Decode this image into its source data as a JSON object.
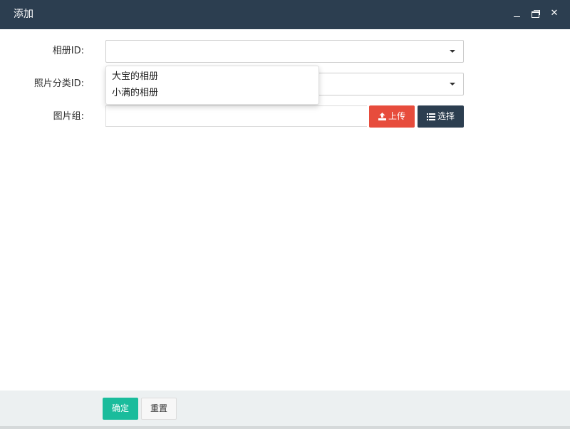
{
  "dialog": {
    "title": "添加",
    "controls": {
      "minimize_icon": "minimize-icon",
      "maximize_icon": "maximize-icon",
      "close_icon": "close-icon",
      "close_glyph": "✕"
    }
  },
  "form": {
    "album_label": "相册ID:",
    "album_value": "",
    "album_dropdown": [
      "大宝的相册",
      "小满的相册"
    ],
    "category_label": "照片分类ID:",
    "category_value": "",
    "images_label": "图片组:",
    "images_value": "",
    "upload_label": "上传",
    "choose_label": "选择"
  },
  "footer": {
    "ok_label": "确定",
    "reset_label": "重置"
  },
  "colors": {
    "titlebar": "#2c3e50",
    "upload_button": "#e74c3c",
    "choose_button": "#2c3e50",
    "ok_button": "#1abc9c",
    "footer_bg": "#ecf0f1"
  }
}
